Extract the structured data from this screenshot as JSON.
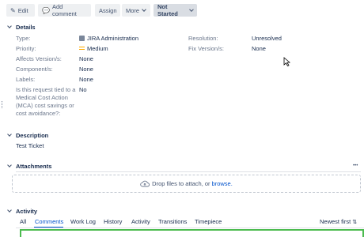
{
  "toolbar": {
    "edit_label": "Edit",
    "add_comment_label": "Add comment",
    "assign_label": "Assign",
    "more_label": "More",
    "status_label": "Not Started"
  },
  "details": {
    "title": "Details",
    "type_label": "Type:",
    "type_value": "JIRA Administration",
    "priority_label": "Priority:",
    "priority_value": "Medium",
    "affects_label": "Affects Version/s:",
    "affects_value": "None",
    "components_label": "Component/s:",
    "components_value": "None",
    "labels_label": "Labels:",
    "labels_value": "None",
    "mca_label_1": "Is this request tied to a",
    "mca_label_2": "Medical Cost Action",
    "mca_label_3": "(MCA) cost savings or",
    "mca_label_4": "cost avoidance?:",
    "mca_value": "No",
    "resolution_label": "Resolution:",
    "resolution_value": "Unresolved",
    "fix_label": "Fix Version/s:",
    "fix_value": "None"
  },
  "description": {
    "title": "Description",
    "text": "Test Ticket"
  },
  "attachments": {
    "title": "Attachments",
    "more": "•••",
    "drop_text": "Drop files to attach, or",
    "browse_link": "browse."
  },
  "activity": {
    "title": "Activity",
    "tabs": [
      "All",
      "Comments",
      "Work Log",
      "History",
      "Activity",
      "Transitions",
      "Timepiece"
    ],
    "sort_label": "Newest first"
  },
  "colors": {
    "accent": "#0052cc",
    "priority": "#ffab00",
    "highlight_border": "#4cbb4f"
  }
}
